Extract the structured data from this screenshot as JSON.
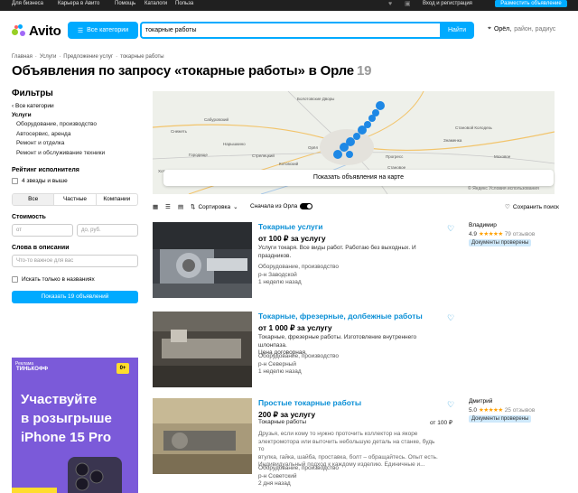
{
  "topbar": {
    "links": [
      "Для бизнеса",
      "Карьера в Авито",
      "Помощь",
      "Каталоги",
      "Польза"
    ],
    "login": "Вход и регистрация",
    "post_ad": "Разместить объявление"
  },
  "header": {
    "logo": "Avito",
    "categories_button": "Все категории",
    "search_value": "токарные работы",
    "find_button": "Найти",
    "location": "Орёл,",
    "location_hint": "район, радиус"
  },
  "breadcrumbs": [
    "Главная",
    "Услуги",
    "Предложение услуг",
    "токарные работы"
  ],
  "page": {
    "title": "Объявления по запросу «токарные работы» в Орле",
    "count": "19"
  },
  "filters": {
    "heading": "Фильтры",
    "back": "Все категории",
    "group": "Услуги",
    "categories": [
      "Оборудование, производство",
      "Автосервис, аренда",
      "Ремонт и отделка",
      "Ремонт и обслуживание техники"
    ],
    "rating_label": "Рейтинг исполнителя",
    "rating_option": "4 звезды и выше",
    "seller_types": [
      "Все",
      "Частные",
      "Компании"
    ],
    "price_label": "Стоимость",
    "price_from": "от",
    "price_to": "до, руб.",
    "words_label": "Слова в описании",
    "words_placeholder": "Что-то важное для вас",
    "titles_only": "Искать только в названиях",
    "show_button": "Показать 19 объявлений"
  },
  "banner": {
    "tag": "Реклама",
    "brand": "ТИНЬКОФФ",
    "badge": "0+",
    "lines": [
      "Участвуйте",
      "в розыгрыше",
      "iPhone 15 Pro"
    ]
  },
  "map": {
    "button": "Показать объявления на карте",
    "attribution": "© Яндекс Условия использования",
    "places": [
      "Болотовские Дворы",
      "Сабуровский",
      "Снежеть",
      "Нарышкино",
      "Городище",
      "Стрелецкий",
      "Котовский",
      "Становой Колодезь",
      "Знаменка",
      "Прогресс",
      "Моховое",
      "Становое",
      "Хотетово",
      "Орёл"
    ]
  },
  "toolbar": {
    "sort": "Сортировка",
    "near": "Сначала из Орла",
    "save": "Сохранить поиск"
  },
  "listings": [
    {
      "title": "Токарные услуги",
      "price": "от 100 ₽ за услугу",
      "description": [
        "Услуги токаря. Все виды работ. Работаю без выходных. И",
        "праздников."
      ],
      "category": "Оборудование, производство",
      "district": "р-н Заводской",
      "date": "1 неделю назад",
      "seller": "Владимир",
      "rating": "4.9",
      "stars": "★★★★★",
      "reviews": "79 отзывов",
      "docs": "Документы проверены"
    },
    {
      "title": "Токарные, фрезерные, долбежные работы",
      "price": "от 1 000 ₽ за услугу",
      "description": [
        "Токарные, фрезерные работы. Изготовление внутреннего шлонпаза.",
        "Цена договорная."
      ],
      "category": "Оборудование, производство",
      "district": "р-н Северный",
      "date": "1 неделю назад"
    },
    {
      "title": "Простые токарные работы",
      "price": "200 ₽ за услугу",
      "service": "Токарные работы",
      "service_price": "от 100 ₽",
      "description": [
        "Друзья, если кому то нужно проточить коллектор на якоре",
        "электромотора или выточить небольшую деталь на станке, будь то",
        "втулка, гайка, шайба, проставка, болт – обращайтесь. Опыт есть.",
        "Индивидуальный подход к каждому изделию. Единичные и..."
      ],
      "category": "Оборудование, производство",
      "district": "р-н Советский",
      "date": "2 дня назад",
      "seller": "Дмитрий",
      "rating": "5.0",
      "stars": "★★★★★",
      "reviews": "25 отзывов",
      "docs": "Документы проверены"
    }
  ],
  "colors": {
    "accent": "#00aaff",
    "link": "#0a8fd6",
    "banner": "#7b5ad9",
    "star": "#ffa000"
  }
}
